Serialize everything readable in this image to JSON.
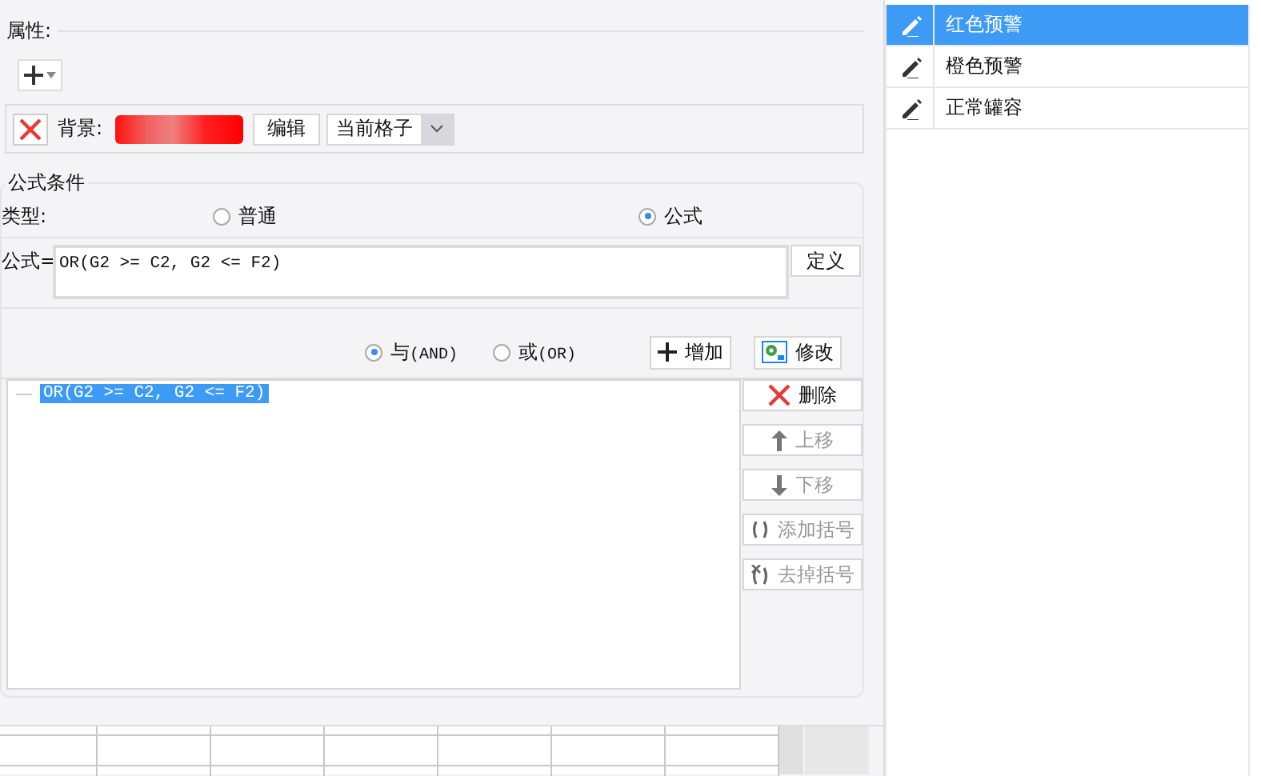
{
  "properties": {
    "title": "属性:",
    "background": {
      "label": "背景:",
      "edit_button": "编辑",
      "scope": "当前格子"
    }
  },
  "formula_condition": {
    "title": "公式条件",
    "type_label": "类型:",
    "type_options": [
      {
        "label": "普通",
        "selected": false
      },
      {
        "label": "公式",
        "selected": true
      }
    ],
    "formula_label": "公式=",
    "formula": "OR(G2 >= C2, G2 <= F2)",
    "define_button": "定义",
    "logic_options": [
      {
        "label": "与",
        "suffix": "(AND)",
        "selected": true
      },
      {
        "label": "或",
        "suffix": "(OR)",
        "selected": false
      }
    ],
    "add_button": "增加",
    "modify_button": "修改",
    "conditions": [
      {
        "text": "OR(G2 >= C2, G2 <= F2)",
        "selected": true
      }
    ],
    "side_buttons": [
      {
        "kind": "delete",
        "label": "删除",
        "disabled": false
      },
      {
        "kind": "up",
        "label": "上移",
        "disabled": true
      },
      {
        "kind": "down",
        "label": "下移",
        "disabled": true
      },
      {
        "kind": "add-paren",
        "label": "添加括号",
        "disabled": true
      },
      {
        "kind": "remove-paren",
        "label": "去掉括号",
        "disabled": true
      }
    ]
  },
  "alerts": [
    {
      "label": "红色预警",
      "selected": true
    },
    {
      "label": "橙色预警",
      "selected": false
    },
    {
      "label": "正常罐容",
      "selected": false
    }
  ]
}
